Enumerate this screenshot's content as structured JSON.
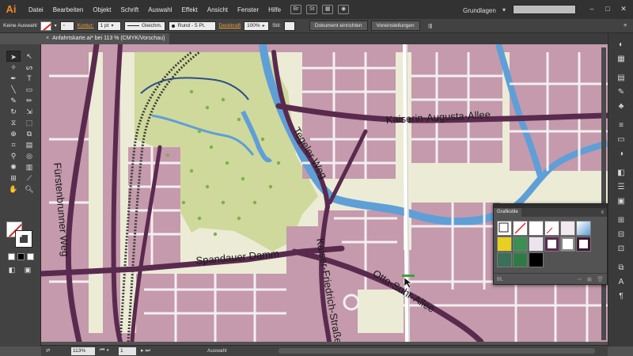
{
  "app": {
    "logo": "Ai"
  },
  "menu": [
    "Datei",
    "Bearbeiten",
    "Objekt",
    "Schrift",
    "Auswahl",
    "Effekt",
    "Ansicht",
    "Fenster",
    "Hilfe"
  ],
  "menubar_icons": {
    "bridge": "Br",
    "stock": "St"
  },
  "workspace": {
    "label": "Grundlagen"
  },
  "control": {
    "selection_label": "Keine Auswahl",
    "stroke_label": "Kontur:",
    "stroke_value": "1 pt",
    "profile_value": "Gleichm.",
    "brush_value": "Rund - 5 Pt.",
    "opacity_label": "Deckkraft",
    "opacity_value": "100%",
    "style_label": "Stil:",
    "doc_setup_button": "Dokument einrichten",
    "prefs_button": "Voreinstellungen"
  },
  "document": {
    "tab_title": "Anfahrtskarte.ai* bei 113 % (CMYK/Vorschau)",
    "close": "×"
  },
  "status": {
    "zoom": "113%",
    "page": "1",
    "tool": "Auswahl"
  },
  "map_labels": {
    "fuerstenbrunner": "Fürstenbrunner Weg",
    "spandauer": "Spandauer Damm",
    "tegeler": "Tegeler Weg",
    "kaiserin": "Kaiserin-Augusta-Allee",
    "kaiser_friedrich": "Kaiser-Friedrich-Straße",
    "otto_suhr": "Otto-Suhr-Allee"
  },
  "colors": {
    "block": "#c49aac",
    "road": "#5a2a4e",
    "park": "#cfd99b",
    "water": "#5f9fd8",
    "paper": "#ecebd6"
  },
  "graphic_styles_panel": {
    "title": "Grafikstile",
    "menu_icon": "panel-menu-icon",
    "library_icon": "library-icon"
  }
}
